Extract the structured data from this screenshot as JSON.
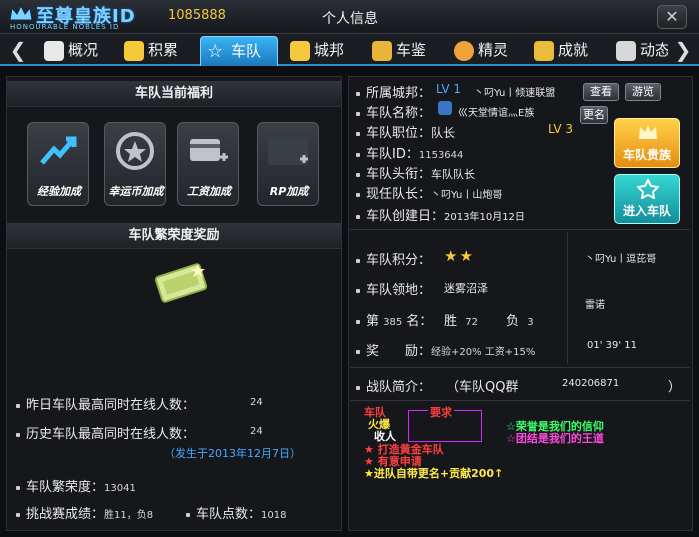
{
  "header": {
    "logo_main": "至尊皇族ID",
    "logo_sub": "HONOURABLE NOBLES ID",
    "user_id": "1085888",
    "title": "个人信息",
    "close": "✕"
  },
  "tabs": [
    {
      "label": "概况",
      "icon": "profile-card-icon"
    },
    {
      "label": "积累",
      "icon": "stack-icon"
    },
    {
      "label": "车队",
      "icon": "star-icon",
      "active": true
    },
    {
      "label": "城邦",
      "icon": "stack-icon"
    },
    {
      "label": "车鉴",
      "icon": "book-icon"
    },
    {
      "label": "精灵",
      "icon": "sprite-icon"
    },
    {
      "label": "成就",
      "icon": "medal-icon"
    },
    {
      "label": "动态",
      "icon": "news-icon"
    }
  ],
  "left": {
    "benefits_title": "车队当前福利",
    "benefits": [
      {
        "label": "经验加成",
        "icon": "exp-boost-icon"
      },
      {
        "label": "幸运币加成",
        "icon": "lucky-coin-icon"
      },
      {
        "label": "工资加成",
        "icon": "salary-card-icon"
      },
      {
        "label": "RP加成",
        "icon": "rp-boost-icon"
      }
    ],
    "prosperity_title": "车队繁荣度奖励",
    "stats": {
      "yesterday_label": "昨日车队最高同时在线人数：",
      "yesterday_value": "24",
      "history_label": "历史车队最高同时在线人数：",
      "history_value": "24",
      "history_date": "（发生于2013年12月7日）",
      "prosperity_label": "车队繁荣度：",
      "prosperity_value": "13041",
      "challenge_label": "挑战赛成绩：",
      "challenge_value": "胜11，负8",
      "points_label": "车队点数：",
      "points_value": "1018"
    }
  },
  "right": {
    "city_label": "所属城邦：",
    "city_level": "LV 1",
    "city_name": "丶叼Yu丨倾速联盟",
    "view_btn": "查看",
    "visit_btn": "游览",
    "team_name_label": "车队名称：",
    "team_name": "巛天堂情谊灬E族",
    "rename_btn": "更名",
    "position_label": "车队职位：",
    "position": "队长",
    "position_level": "LV 3",
    "id_label": "车队ID：",
    "id": "1153644",
    "title_label": "车队头衔：",
    "title": "车队队长",
    "captain_label": "现任队长：",
    "captain": "丶叼Yu丨山炮哥",
    "created_label": "车队创建日：",
    "created": "2013年10月12日",
    "noble_btn": "车队贵族",
    "enter_btn": "进入车队",
    "score_label": "车队积分：",
    "territory_label": "车队领地：",
    "territory": "迷雾沼泽",
    "rank_prefix": "第",
    "rank": "385",
    "rank_suffix": "名：",
    "win_label": "胜",
    "win": "72",
    "lose_label": "负",
    "lose": "3",
    "reward_label": "奖　　励：",
    "reward": "经验+20% 工资+15%",
    "side_name1": "丶叼Yu丨逗芘哥",
    "side_name2": "雷诺",
    "side_time": "01' 39' 11",
    "intro_label": "战队简介：",
    "intro_qq": "（车队QQ群",
    "intro_qq_num": "240206871",
    "intro_close": "）",
    "motto": {
      "a": "车队",
      "b": "火爆",
      "c": "收人",
      "req": "要求",
      "r1": "★ 打造黄金车队",
      "r2": "★ 有意申请",
      "r3": "★进队自带更名+贡献200↑",
      "s1": "☆荣誉是我们的信仰",
      "s2": "☆团结是我们的王道"
    }
  },
  "colors": {
    "accent": "#2a8fd0",
    "gold": "#f5c93a",
    "blue_text": "#4aa8ff"
  }
}
